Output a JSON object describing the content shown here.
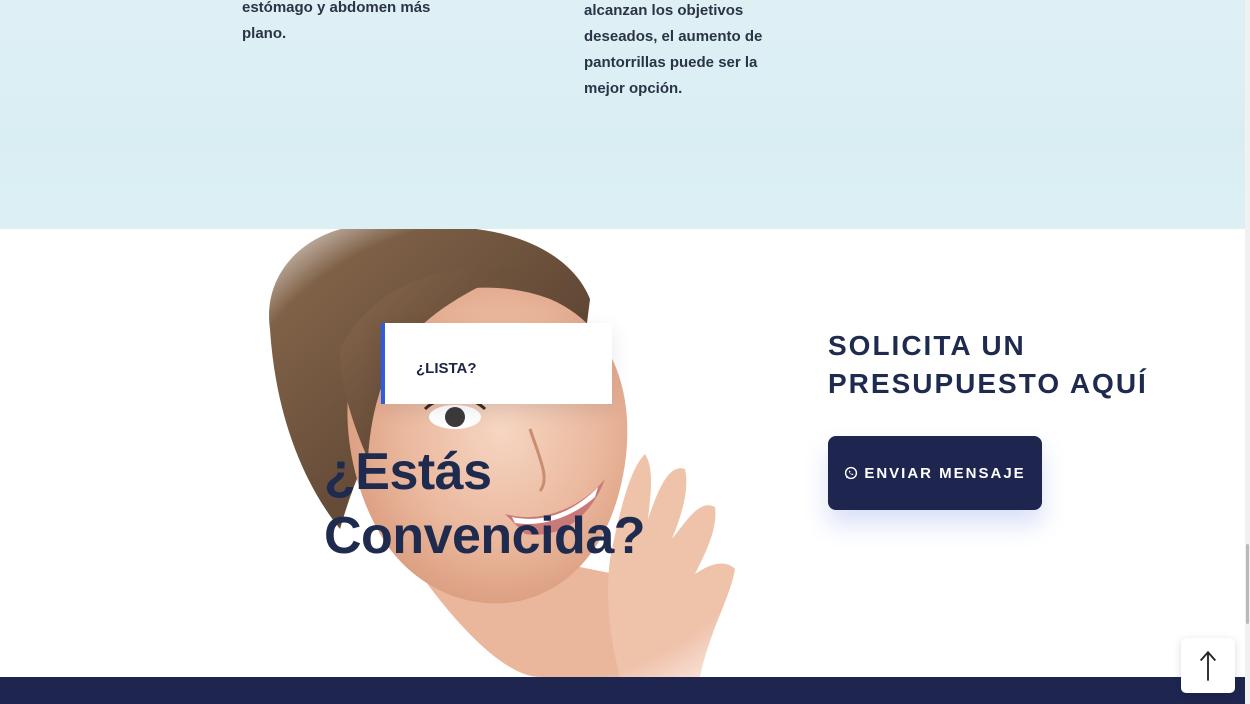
{
  "features": {
    "left_text": "estómago y abdomen más plano.",
    "right_text": "alcanzan los objetivos deseados, el aumento de pantorrillas puede ser la mejor opción."
  },
  "hero": {
    "card_label": "¿LISTA?",
    "heading": "¿Estás Convencida?"
  },
  "cta": {
    "title": "SOLICITA UN PRESUPUESTO AQUÍ",
    "button_label": "ENVIAR MENSAJE",
    "button_icon": "whatsapp-icon"
  },
  "back_to_top_icon": "arrow-up-icon",
  "colors": {
    "navy": "#1e2650",
    "accent_blue": "#2f5be0",
    "light_band": "#dff0f5"
  }
}
